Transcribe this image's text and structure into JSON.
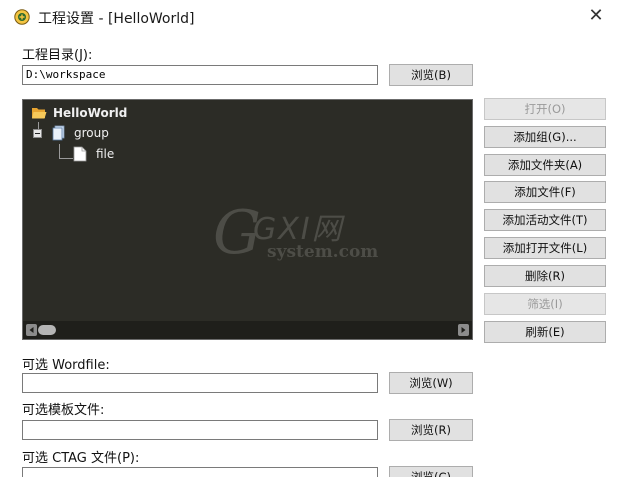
{
  "window": {
    "title": "工程设置 - [HelloWorld]",
    "close_glyph": "✕"
  },
  "project_dir": {
    "label": "工程目录(J):",
    "value": "D:\\workspace",
    "browse_label": "浏览(B)"
  },
  "tree": {
    "root": "HelloWorld",
    "group": "group",
    "file": "file",
    "watermark_brand": "GXI网",
    "watermark_domain": "system.com"
  },
  "side_buttons": [
    {
      "label": "打开(O)",
      "enabled": false
    },
    {
      "label": "添加组(G)...",
      "enabled": true
    },
    {
      "label": "添加文件夹(A)",
      "enabled": true
    },
    {
      "label": "添加文件(F)",
      "enabled": true
    },
    {
      "label": "添加活动文件(T)",
      "enabled": true
    },
    {
      "label": "添加打开文件(L)",
      "enabled": true
    },
    {
      "label": "删除(R)",
      "enabled": true
    },
    {
      "label": "筛选(I)",
      "enabled": false
    },
    {
      "label": "刷新(E)",
      "enabled": true
    }
  ],
  "wordfile": {
    "label": "可选 Wordfile:",
    "value": "",
    "browse_label": "浏览(W)"
  },
  "template": {
    "label": "可选模板文件:",
    "value": "",
    "browse_label": "浏览(R)"
  },
  "ctag": {
    "label": "可选 CTAG 文件(P):",
    "value": "",
    "browse_label": "浏览(C)"
  },
  "icons": {
    "app": "app-icon",
    "folder": "folder-open-icon",
    "group": "group-icon",
    "file": "file-icon"
  }
}
